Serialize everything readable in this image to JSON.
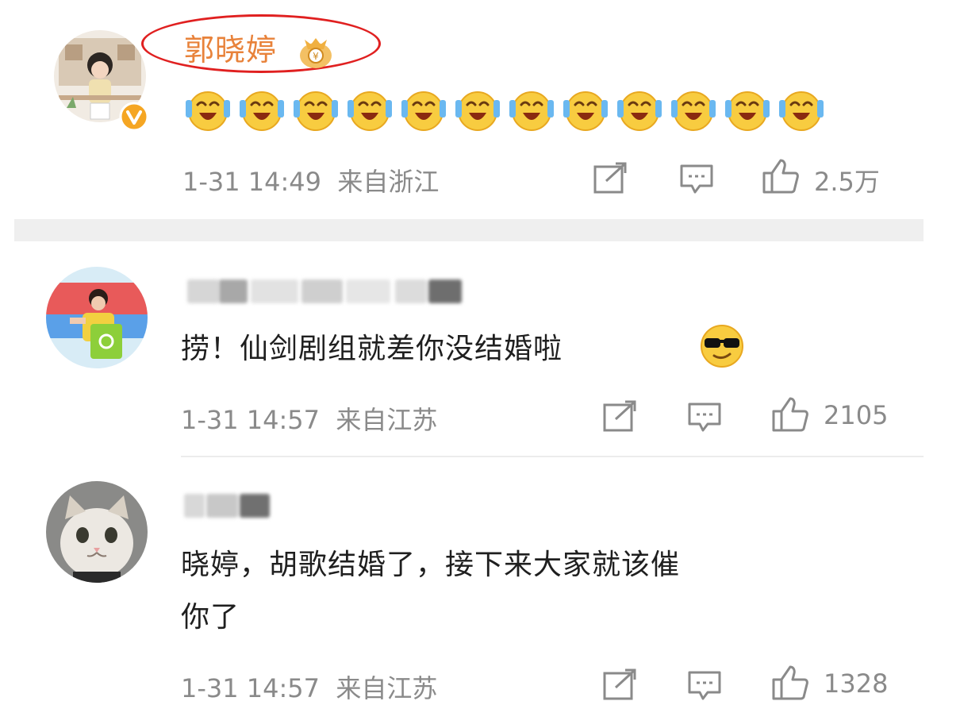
{
  "posts": [
    {
      "author": "郭晓婷",
      "badge_icon": "money-bag-icon",
      "verified_icon": "verified-v-icon",
      "emoji_count_icon": "laughing-crying-emoji-icon",
      "time": "1-31 14:49",
      "location": "来自浙江",
      "likes": "2.5万"
    },
    {
      "author_blurred": true,
      "text": "捞！仙剑剧组就差你没结婚啦",
      "emoji": "sunglasses-emoji-icon",
      "time": "1-31 14:57",
      "location": "来自江苏",
      "likes": "2105"
    },
    {
      "author_blurred": true,
      "text_line1": "晓婷，胡歌结婚了，接下来大家就该催",
      "text_line2": "你了",
      "time": "1-31 14:57",
      "location": "来自江苏",
      "likes": "1328"
    }
  ],
  "colors": {
    "name_orange": "#e8823a",
    "highlight_red": "#e02020",
    "meta_gray": "#8a8a8a",
    "divider_gray": "#efefef"
  },
  "icons": {
    "share": "share-icon",
    "comment": "comment-icon",
    "like": "thumbs-up-icon"
  }
}
